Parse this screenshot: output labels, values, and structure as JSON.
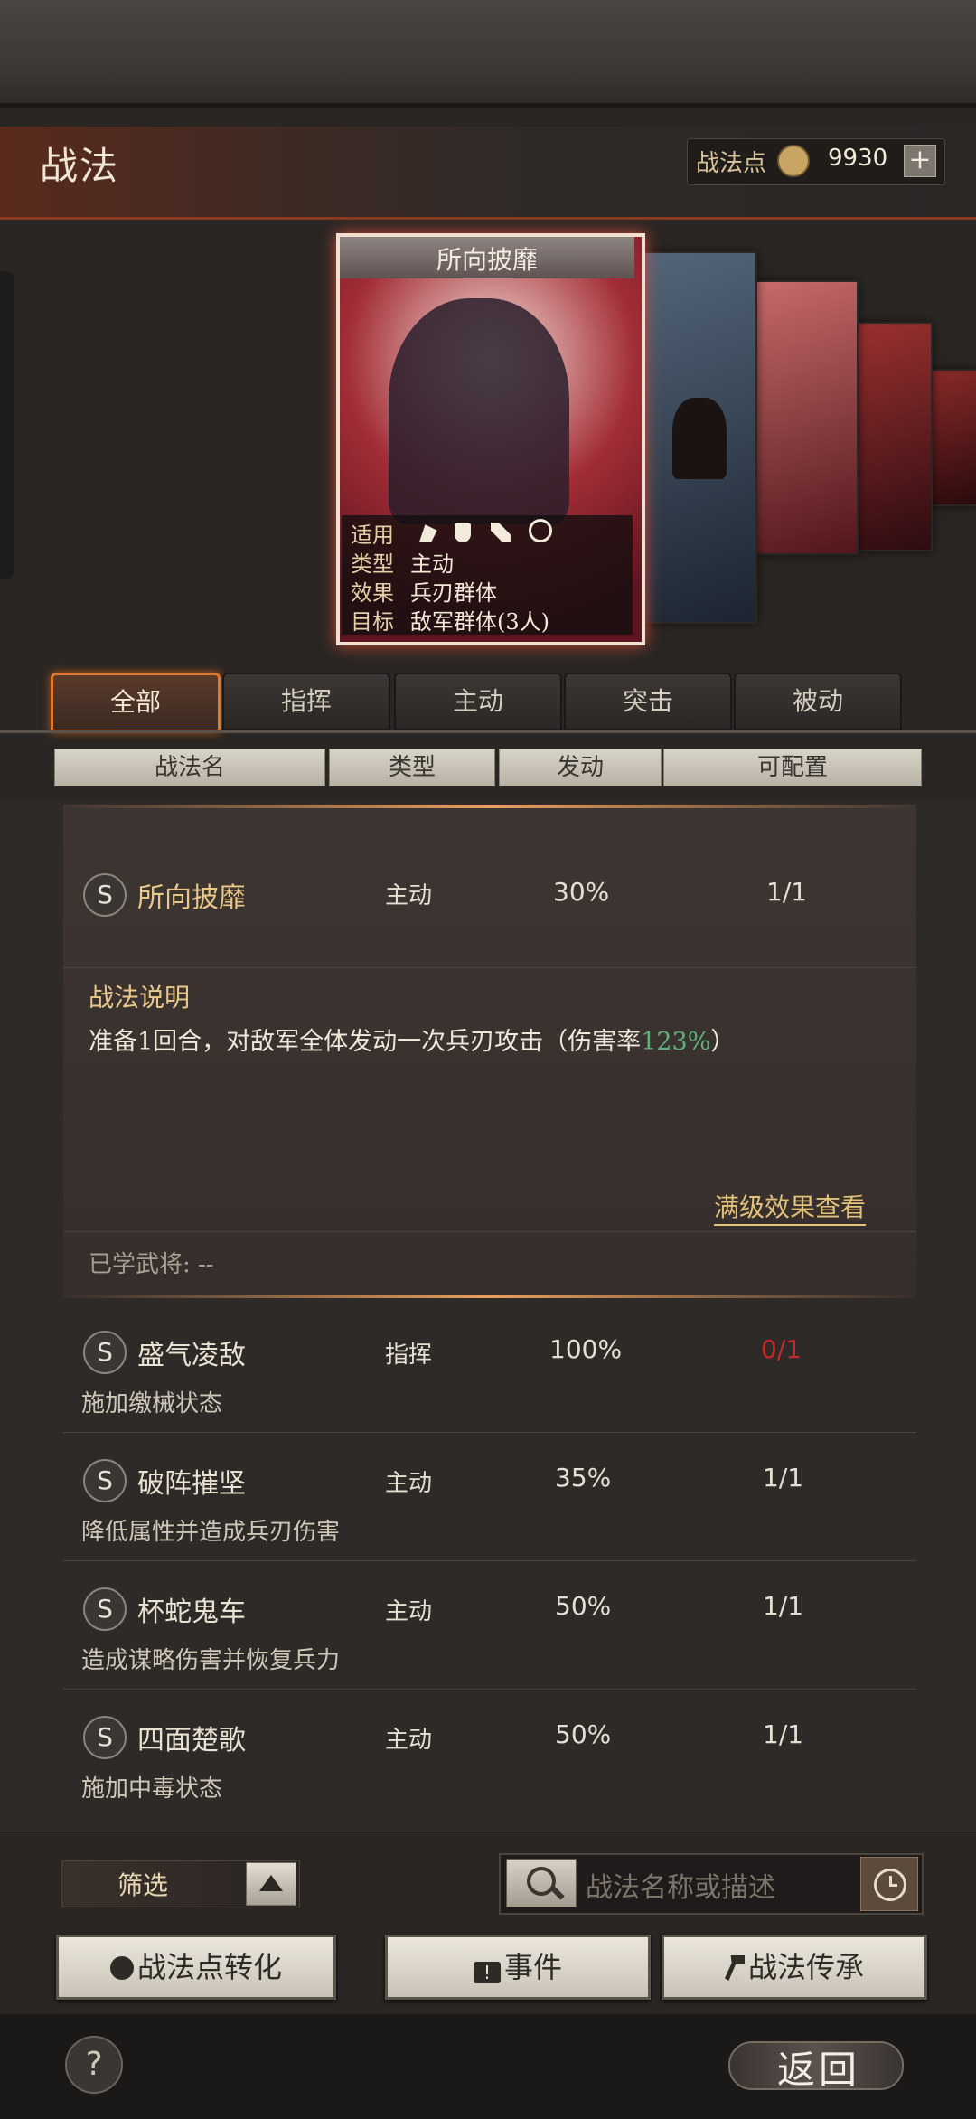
{
  "header": {
    "title": "战法",
    "points_label": "战法点",
    "points_value": "9930",
    "plus": "+"
  },
  "featured_card": {
    "name": "所向披靡",
    "rows": [
      {
        "key": "适用",
        "value": ""
      },
      {
        "key": "类型",
        "value": "主动"
      },
      {
        "key": "效果",
        "value": "兵刃群体"
      },
      {
        "key": "目标",
        "value": "敌军群体(3人)"
      }
    ],
    "troop_icons": [
      "cavalry-icon",
      "shield-icon",
      "archer-icon",
      "chariot-icon"
    ]
  },
  "tabs": [
    {
      "label": "全部",
      "active": true
    },
    {
      "label": "指挥",
      "active": false
    },
    {
      "label": "主动",
      "active": false
    },
    {
      "label": "突击",
      "active": false
    },
    {
      "label": "被动",
      "active": false
    }
  ],
  "columns": [
    "战法名",
    "类型",
    "发动",
    "可配置"
  ],
  "expanded": {
    "badge": "S",
    "name": "所向披靡",
    "type": "主动",
    "rate": "30%",
    "config": "1/1",
    "desc_title": "战法说明",
    "desc_before": "准备1回合，对敌军全体发动一次兵刃攻击（伤害率",
    "desc_highlight": "123%",
    "desc_after": "）",
    "max_link": "满级效果查看",
    "learned": "已学武将: --"
  },
  "rows": [
    {
      "badge": "S",
      "name": "盛气凌敌",
      "type": "指挥",
      "rate": "100%",
      "config": "0/1",
      "config_color": "#c4282a",
      "desc": "施加缴械状态"
    },
    {
      "badge": "S",
      "name": "破阵摧坚",
      "type": "主动",
      "rate": "35%",
      "config": "1/1",
      "config_color": "#e6dfd1",
      "desc": "降低属性并造成兵刃伤害"
    },
    {
      "badge": "S",
      "name": "杯蛇鬼车",
      "type": "主动",
      "rate": "50%",
      "config": "1/1",
      "config_color": "#e6dfd1",
      "desc": "造成谋略伤害并恢复兵力"
    },
    {
      "badge": "S",
      "name": "四面楚歌",
      "type": "主动",
      "rate": "50%",
      "config": "1/1",
      "config_color": "#e6dfd1",
      "desc": "施加中毒状态"
    }
  ],
  "controls": {
    "filter": "筛选",
    "search_placeholder": "战法名称或描述",
    "btn_convert": "战法点转化",
    "btn_event": "事件",
    "btn_inherit": "战法传承",
    "help": "?",
    "back": "返回"
  },
  "colors": {
    "accent": "#e07a2a",
    "highlight_green": "#5fb07a",
    "link": "#e3c27a",
    "warn_red": "#c4282a"
  }
}
